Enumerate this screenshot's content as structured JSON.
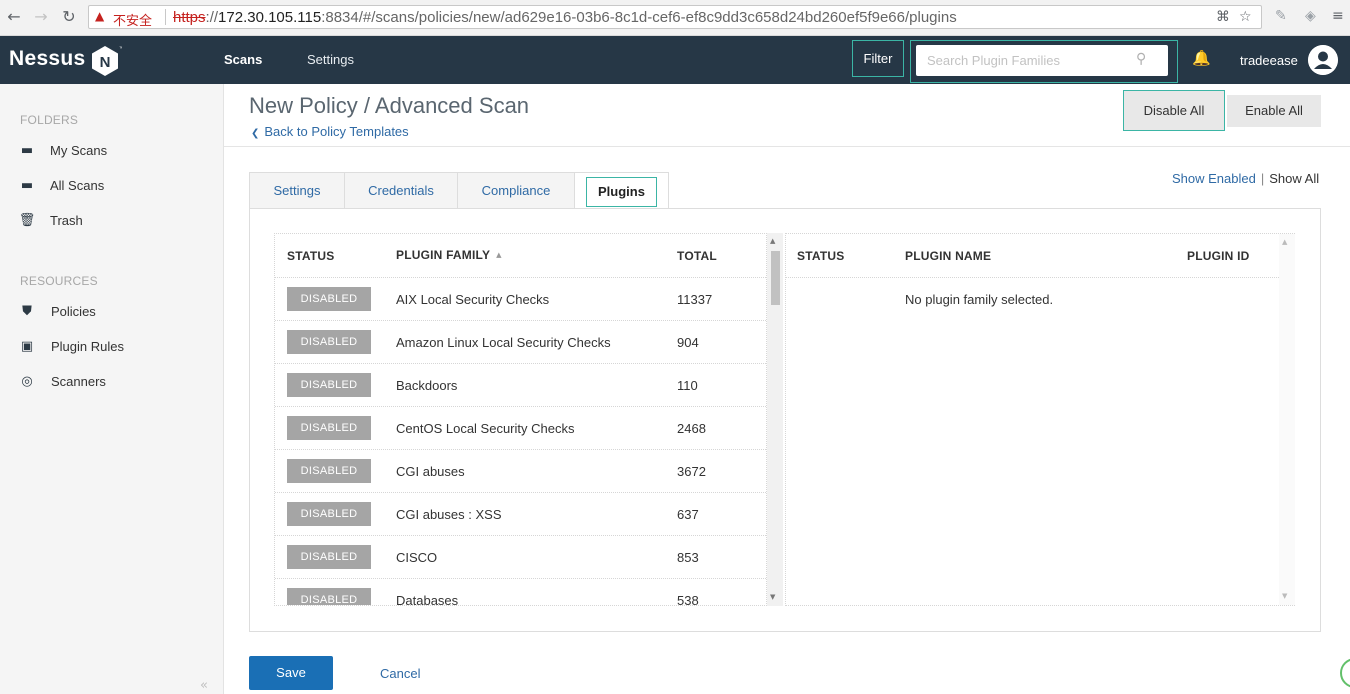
{
  "browser": {
    "insecure_label": "不安全",
    "url_scheme": "https",
    "url_host": "172.30.105.115",
    "url_rest": ":8834/#/scans/policies/new/ad629e16-03b6-8c1d-cef6-ef8c9dd3c658d24bd260ef5f9e66/plugins"
  },
  "header": {
    "logo_text": "Nessus",
    "logo_letter": "N",
    "logo_tm": "™",
    "nav": [
      {
        "label": "Scans",
        "active": true
      },
      {
        "label": "Settings",
        "active": false
      }
    ],
    "filter_label": "Filter",
    "search_placeholder": "Search Plugin Families",
    "username": "tradeease"
  },
  "sidebar": {
    "folders_heading": "FOLDERS",
    "folders": [
      {
        "label": "My Scans",
        "icon": "folder-icon"
      },
      {
        "label": "All Scans",
        "icon": "folder-icon"
      },
      {
        "label": "Trash",
        "icon": "trash-icon"
      }
    ],
    "resources_heading": "RESOURCES",
    "resources": [
      {
        "label": "Policies",
        "icon": "policy-shield-icon"
      },
      {
        "label": "Plugin Rules",
        "icon": "plugin-rules-icon"
      },
      {
        "label": "Scanners",
        "icon": "scanner-icon"
      }
    ]
  },
  "page": {
    "title": "New Policy / Advanced Scan",
    "back_label": "Back to Policy Templates",
    "disable_all_label": "Disable All",
    "enable_all_label": "Enable All",
    "tabs": [
      "Settings",
      "Credentials",
      "Compliance",
      "Plugins"
    ],
    "active_tab": "Plugins",
    "show_enabled_label": "Show Enabled",
    "show_separator": "|",
    "show_all_label": "Show All"
  },
  "families_table": {
    "columns": [
      "STATUS",
      "PLUGIN FAMILY",
      "TOTAL"
    ],
    "rows": [
      {
        "status": "DISABLED",
        "family": "AIX Local Security Checks",
        "total": "11337"
      },
      {
        "status": "DISABLED",
        "family": "Amazon Linux Local Security Checks",
        "total": "904"
      },
      {
        "status": "DISABLED",
        "family": "Backdoors",
        "total": "110"
      },
      {
        "status": "DISABLED",
        "family": "CentOS Local Security Checks",
        "total": "2468"
      },
      {
        "status": "DISABLED",
        "family": "CGI abuses",
        "total": "3672"
      },
      {
        "status": "DISABLED",
        "family": "CGI abuses : XSS",
        "total": "637"
      },
      {
        "status": "DISABLED",
        "family": "CISCO",
        "total": "853"
      },
      {
        "status": "DISABLED",
        "family": "Databases",
        "total": "538"
      }
    ]
  },
  "plugins_table": {
    "columns": [
      "STATUS",
      "PLUGIN NAME",
      "PLUGIN ID"
    ],
    "empty_message": "No plugin family selected."
  },
  "footer": {
    "save_label": "Save",
    "cancel_label": "Cancel"
  },
  "colors": {
    "topbar": "#263746",
    "accent_teal": "#3bb5a5",
    "link_blue": "#2f6aa5",
    "save_blue": "#1a6fb5",
    "disabled_badge": "#a5a5a5"
  }
}
